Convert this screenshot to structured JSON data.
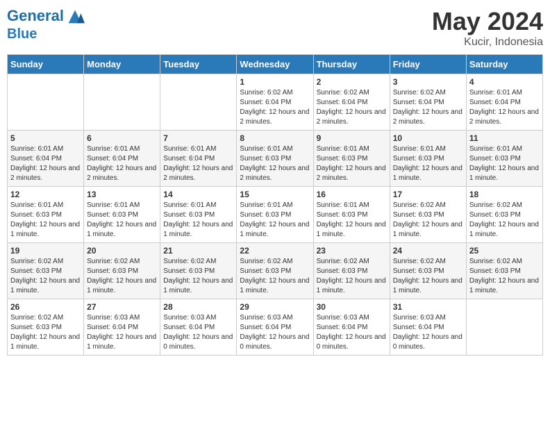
{
  "header": {
    "logo_line1": "General",
    "logo_line2": "Blue",
    "month": "May 2024",
    "location": "Kucir, Indonesia"
  },
  "weekdays": [
    "Sunday",
    "Monday",
    "Tuesday",
    "Wednesday",
    "Thursday",
    "Friday",
    "Saturday"
  ],
  "weeks": [
    [
      {
        "day": "",
        "sunrise": "",
        "sunset": "",
        "daylight": ""
      },
      {
        "day": "",
        "sunrise": "",
        "sunset": "",
        "daylight": ""
      },
      {
        "day": "",
        "sunrise": "",
        "sunset": "",
        "daylight": ""
      },
      {
        "day": "1",
        "sunrise": "6:02 AM",
        "sunset": "6:04 PM",
        "daylight": "12 hours and 2 minutes."
      },
      {
        "day": "2",
        "sunrise": "6:02 AM",
        "sunset": "6:04 PM",
        "daylight": "12 hours and 2 minutes."
      },
      {
        "day": "3",
        "sunrise": "6:02 AM",
        "sunset": "6:04 PM",
        "daylight": "12 hours and 2 minutes."
      },
      {
        "day": "4",
        "sunrise": "6:01 AM",
        "sunset": "6:04 PM",
        "daylight": "12 hours and 2 minutes."
      }
    ],
    [
      {
        "day": "5",
        "sunrise": "6:01 AM",
        "sunset": "6:04 PM",
        "daylight": "12 hours and 2 minutes."
      },
      {
        "day": "6",
        "sunrise": "6:01 AM",
        "sunset": "6:04 PM",
        "daylight": "12 hours and 2 minutes."
      },
      {
        "day": "7",
        "sunrise": "6:01 AM",
        "sunset": "6:04 PM",
        "daylight": "12 hours and 2 minutes."
      },
      {
        "day": "8",
        "sunrise": "6:01 AM",
        "sunset": "6:03 PM",
        "daylight": "12 hours and 2 minutes."
      },
      {
        "day": "9",
        "sunrise": "6:01 AM",
        "sunset": "6:03 PM",
        "daylight": "12 hours and 2 minutes."
      },
      {
        "day": "10",
        "sunrise": "6:01 AM",
        "sunset": "6:03 PM",
        "daylight": "12 hours and 1 minute."
      },
      {
        "day": "11",
        "sunrise": "6:01 AM",
        "sunset": "6:03 PM",
        "daylight": "12 hours and 1 minute."
      }
    ],
    [
      {
        "day": "12",
        "sunrise": "6:01 AM",
        "sunset": "6:03 PM",
        "daylight": "12 hours and 1 minute."
      },
      {
        "day": "13",
        "sunrise": "6:01 AM",
        "sunset": "6:03 PM",
        "daylight": "12 hours and 1 minute."
      },
      {
        "day": "14",
        "sunrise": "6:01 AM",
        "sunset": "6:03 PM",
        "daylight": "12 hours and 1 minute."
      },
      {
        "day": "15",
        "sunrise": "6:01 AM",
        "sunset": "6:03 PM",
        "daylight": "12 hours and 1 minute."
      },
      {
        "day": "16",
        "sunrise": "6:01 AM",
        "sunset": "6:03 PM",
        "daylight": "12 hours and 1 minute."
      },
      {
        "day": "17",
        "sunrise": "6:02 AM",
        "sunset": "6:03 PM",
        "daylight": "12 hours and 1 minute."
      },
      {
        "day": "18",
        "sunrise": "6:02 AM",
        "sunset": "6:03 PM",
        "daylight": "12 hours and 1 minute."
      }
    ],
    [
      {
        "day": "19",
        "sunrise": "6:02 AM",
        "sunset": "6:03 PM",
        "daylight": "12 hours and 1 minute."
      },
      {
        "day": "20",
        "sunrise": "6:02 AM",
        "sunset": "6:03 PM",
        "daylight": "12 hours and 1 minute."
      },
      {
        "day": "21",
        "sunrise": "6:02 AM",
        "sunset": "6:03 PM",
        "daylight": "12 hours and 1 minute."
      },
      {
        "day": "22",
        "sunrise": "6:02 AM",
        "sunset": "6:03 PM",
        "daylight": "12 hours and 1 minute."
      },
      {
        "day": "23",
        "sunrise": "6:02 AM",
        "sunset": "6:03 PM",
        "daylight": "12 hours and 1 minute."
      },
      {
        "day": "24",
        "sunrise": "6:02 AM",
        "sunset": "6:03 PM",
        "daylight": "12 hours and 1 minute."
      },
      {
        "day": "25",
        "sunrise": "6:02 AM",
        "sunset": "6:03 PM",
        "daylight": "12 hours and 1 minute."
      }
    ],
    [
      {
        "day": "26",
        "sunrise": "6:02 AM",
        "sunset": "6:03 PM",
        "daylight": "12 hours and 1 minute."
      },
      {
        "day": "27",
        "sunrise": "6:03 AM",
        "sunset": "6:04 PM",
        "daylight": "12 hours and 1 minute."
      },
      {
        "day": "28",
        "sunrise": "6:03 AM",
        "sunset": "6:04 PM",
        "daylight": "12 hours and 0 minutes."
      },
      {
        "day": "29",
        "sunrise": "6:03 AM",
        "sunset": "6:04 PM",
        "daylight": "12 hours and 0 minutes."
      },
      {
        "day": "30",
        "sunrise": "6:03 AM",
        "sunset": "6:04 PM",
        "daylight": "12 hours and 0 minutes."
      },
      {
        "day": "31",
        "sunrise": "6:03 AM",
        "sunset": "6:04 PM",
        "daylight": "12 hours and 0 minutes."
      },
      {
        "day": "",
        "sunrise": "",
        "sunset": "",
        "daylight": ""
      }
    ]
  ],
  "labels": {
    "sunrise": "Sunrise:",
    "sunset": "Sunset:",
    "daylight": "Daylight:"
  }
}
